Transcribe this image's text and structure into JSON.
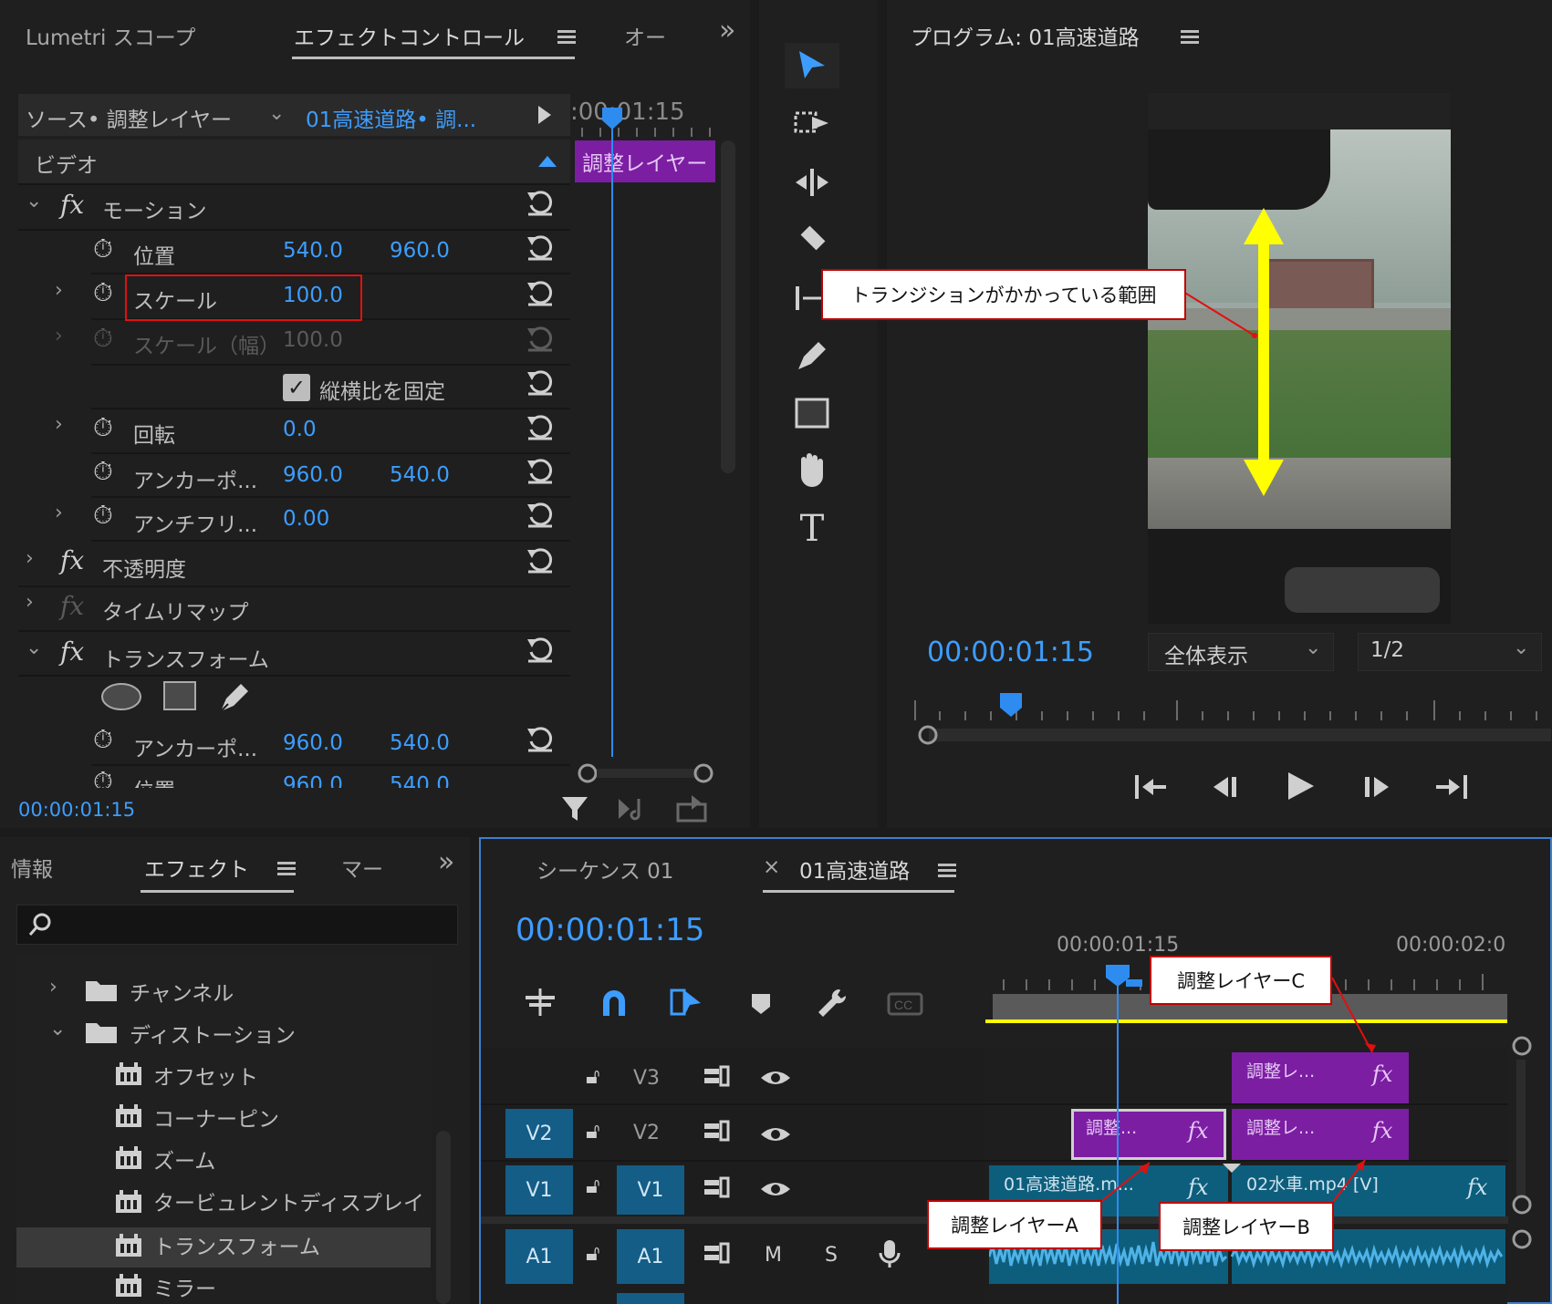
{
  "effect_panel": {
    "tabs": [
      "Lumetri スコープ",
      "エフェクトコントロール",
      "オー"
    ],
    "more": "»",
    "source_label": "ソース• 調整レイヤー",
    "source_clip": "01高速道路• 調...",
    "mini_time": ":00:01:15",
    "mini_clip_label": "調整レイヤー",
    "section": "ビデオ",
    "motion": "モーション",
    "position_label": "位置",
    "position_x": "540.0",
    "position_y": "960.0",
    "scale_label": "スケール",
    "scale_value": "100.0",
    "scale_width_label": "スケール（幅）",
    "scale_width_value": "100.0",
    "uniform_scale": "縦横比を固定",
    "rotation_label": "回転",
    "rotation_value": "0.0",
    "anchor_label": "アンカーポ...",
    "anchor_x": "960.0",
    "anchor_y": "540.0",
    "antiflicker_label": "アンチフリ...",
    "antiflicker_value": "0.00",
    "opacity": "不透明度",
    "time_remap": "タイムリマップ",
    "transform": "トランスフォーム",
    "t_anchor_label": "アンカーポ...",
    "t_anchor_x": "960.0",
    "t_anchor_y": "540.0",
    "t_position_label": "位置",
    "t_position_x": "960.0",
    "t_position_y": "540.0",
    "timecode": "00:00:01:15"
  },
  "program_monitor": {
    "title": "プログラム: 01高速道路",
    "timecode": "00:00:01:15",
    "fit": "全体表示",
    "resolution": "1/2"
  },
  "annotations": {
    "transition_range": "トランジションがかかっている範囲",
    "layer_a": "調整レイヤーA",
    "layer_b": "調整レイヤーB",
    "layer_c": "調整レイヤーC"
  },
  "effects_panel": {
    "tabs": [
      "情報",
      "エフェクト",
      "マー"
    ],
    "more": "»",
    "search_placeholder": "",
    "items": [
      "チャンネル",
      "ディストーション",
      "オフセット",
      "コーナーピン",
      "ズーム",
      "タービュレントディスプレイ",
      "トランスフォーム",
      "ミラー"
    ]
  },
  "timeline": {
    "tab_sequence": "シーケンス 01",
    "close": "×",
    "tab_active": "01高速道路",
    "timecode": "00:00:01:15",
    "ruler_time1": "00:00:01:15",
    "ruler_time2": "00:00:02:0",
    "tracks": [
      "V3",
      "V2",
      "V1",
      "A1"
    ],
    "m_label": "M",
    "s_label": "S",
    "clips": {
      "v3_adj": "調整レ...",
      "v2_adj_a": "調整...",
      "v2_adj_b": "調整レ...",
      "v1_a": "01高速道路.m...",
      "v1_b": "02水車.mp4 [V]"
    },
    "fx": "fx"
  },
  "colors": {
    "accent_blue": "#3d9dff",
    "clip_purple": "#7b1ea2",
    "clip_teal": "#0d5e7c",
    "track_blue": "#135d86",
    "highlight_red": "#e01010",
    "arrow_yellow": "#ffff00"
  }
}
